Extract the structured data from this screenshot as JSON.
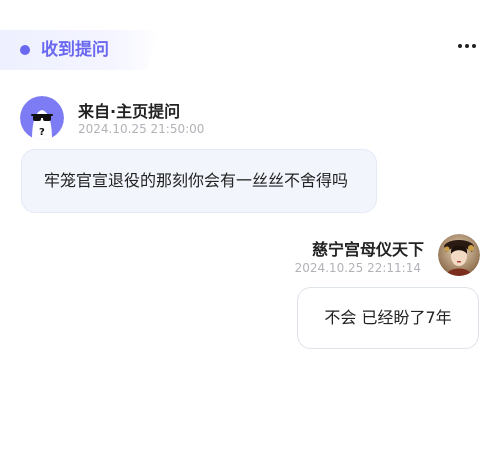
{
  "header": {
    "tag_label": "收到提问",
    "more_icon": "more-horizontal-icon",
    "accent_color": "#6a67f0"
  },
  "question": {
    "sender": "来自·主页提问",
    "timestamp": "2024.10.25 21:50:00",
    "text": "牢笼官宣退役的那刻你会有一丝丝不舍得吗",
    "avatar_icon": "anonymous-sunglasses-icon"
  },
  "answer": {
    "sender": "慈宁宫母仪天下",
    "timestamp": "2024.10.25 22:11:14",
    "text": "不会 已经盼了7年",
    "avatar_icon": "user-avatar-photo"
  }
}
